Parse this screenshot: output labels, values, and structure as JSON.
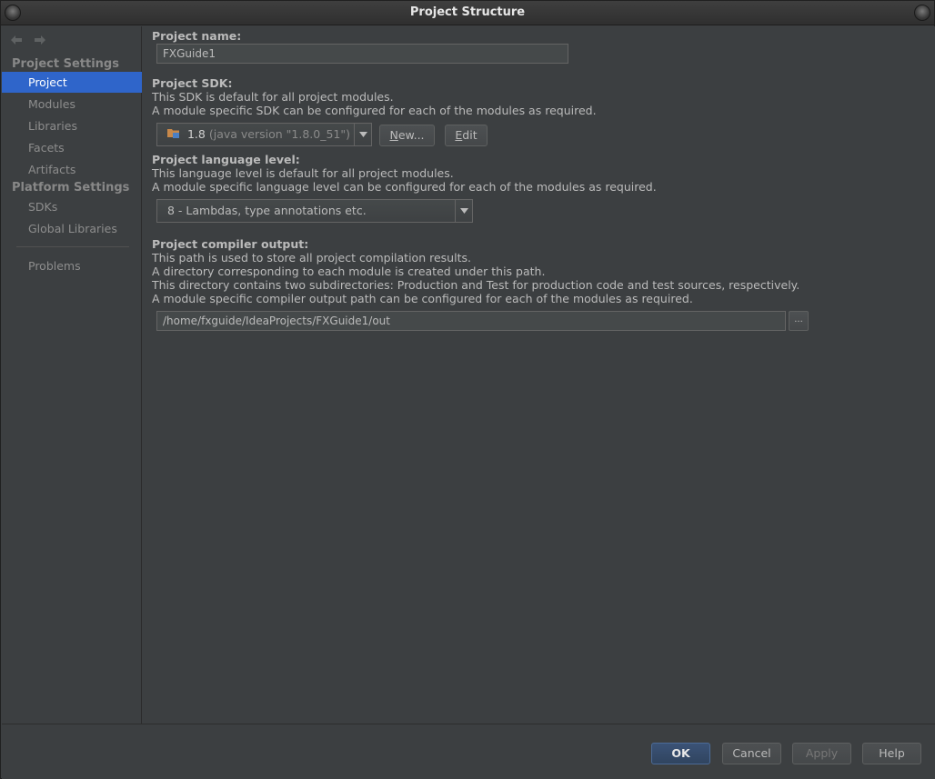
{
  "window": {
    "title": "Project Structure"
  },
  "sidebar": {
    "project_settings_title": "Project Settings",
    "platform_settings_title": "Platform Settings",
    "items": [
      {
        "label": "Project",
        "selected": true
      },
      {
        "label": "Modules"
      },
      {
        "label": "Libraries"
      },
      {
        "label": "Facets"
      },
      {
        "label": "Artifacts"
      },
      {
        "label": "SDKs"
      },
      {
        "label": "Global Libraries"
      },
      {
        "label": "Problems"
      }
    ]
  },
  "main": {
    "project_name": {
      "label": "Project name:",
      "value": "FXGuide1"
    },
    "project_sdk": {
      "label": "Project SDK:",
      "desc1": "This SDK is default for all project modules.",
      "desc2": "A module specific SDK can be configured for each of the modules as required.",
      "selected_version": "1.8",
      "selected_detail": "(java version \"1.8.0_51\")",
      "new_button_prefix": "",
      "new_button_mnemonic": "N",
      "new_button_rest": "ew...",
      "edit_button_mnemonic": "E",
      "edit_button_rest": "dit"
    },
    "language_level": {
      "label": "Project language level:",
      "desc1": "This language level is default for all project modules.",
      "desc2": "A module specific language level can be configured for each of the modules as required.",
      "selected": "8 - Lambdas, type annotations etc."
    },
    "compiler_output": {
      "label": "Project compiler output:",
      "desc1": "This path is used to store all project compilation results.",
      "desc2": "A directory corresponding to each module is created under this path.",
      "desc3": "This directory contains two subdirectories: Production and Test for production code and test sources, respectively.",
      "desc4": "A module specific compiler output path can be configured for each of the modules as required.",
      "path": "/home/fxguide/IdeaProjects/FXGuide1/out",
      "browse_label": "..."
    }
  },
  "footer": {
    "ok_label": "OK",
    "cancel_label": "Cancel",
    "apply_label": "Apply",
    "help_label": "Help"
  },
  "colors": {
    "accent": "#2f65ca",
    "background": "#3c3f41",
    "text": "#bbbbbb"
  }
}
